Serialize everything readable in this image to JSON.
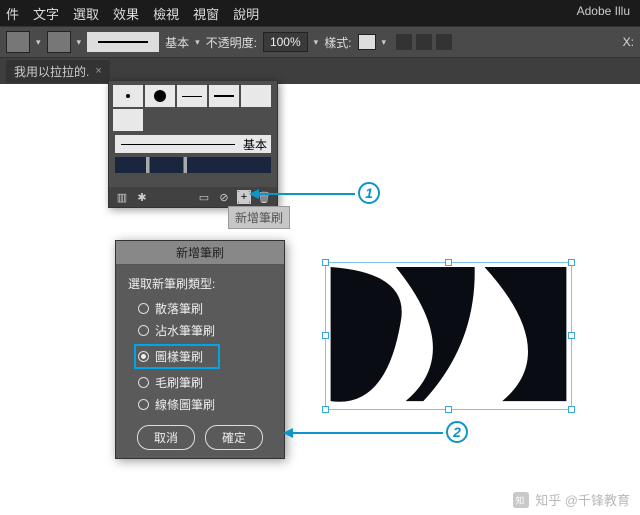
{
  "menubar": [
    "件",
    "文字",
    "選取",
    "效果",
    "檢視",
    "視窗",
    "說明"
  ],
  "brand": "Adobe Illu",
  "toolbar": {
    "brush_label": "基本",
    "opacity_label": "不透明度:",
    "opacity_value": "100%",
    "style_label": "樣式:",
    "x_label": "X:"
  },
  "tabs": {
    "active_label": "我用以拉拉的."
  },
  "brushes_panel": {
    "basic_row_label": "基本",
    "tooltip_new_brush": "新增筆刷"
  },
  "dialog": {
    "title": "新增筆刷",
    "select_label": "選取新筆刷類型:",
    "options": [
      "散落筆刷",
      "沾水筆筆刷",
      "圖樣筆刷",
      "毛刷筆刷",
      "線條圖筆刷"
    ],
    "selected_index": 2,
    "cancel": "取消",
    "ok": "確定"
  },
  "callouts": {
    "one": "1",
    "two": "2"
  },
  "watermark": "知乎 @千锋教育"
}
